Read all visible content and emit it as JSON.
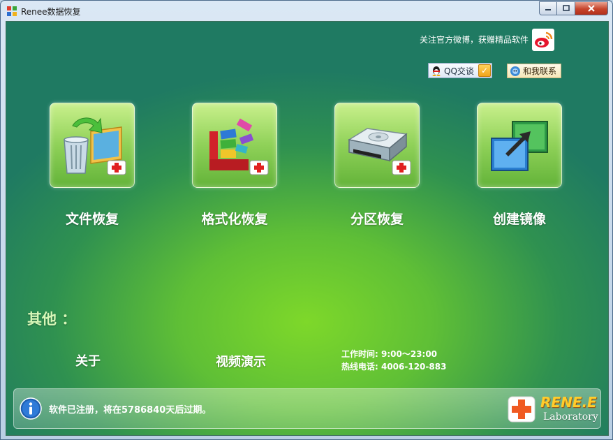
{
  "window": {
    "title": "Renee数据恢复"
  },
  "header": {
    "weibo_text": "关注官方微博，获赠精品软件",
    "qq_label": "QQ交谈",
    "contact_label": "和我联系"
  },
  "tiles": [
    {
      "label": "文件恢复",
      "icon": "file-recovery-icon"
    },
    {
      "label": "格式化恢复",
      "icon": "format-recovery-icon"
    },
    {
      "label": "分区恢复",
      "icon": "partition-recovery-icon"
    },
    {
      "label": "创建镜像",
      "icon": "create-image-icon"
    }
  ],
  "others": {
    "heading": "其他 ：",
    "about": "关于",
    "video_demo": "视频演示",
    "work_hours": "工作时间: 9:00～23:00",
    "hotline": "热线电话: 4006-120-883"
  },
  "status": {
    "text": "软件已注册，将在5786840天后过期。"
  },
  "logo": {
    "main": "RENE.E",
    "sub": "Laboratory"
  },
  "colors": {
    "accent_green": "#7ed82a",
    "deep_green": "#1f7a62"
  }
}
